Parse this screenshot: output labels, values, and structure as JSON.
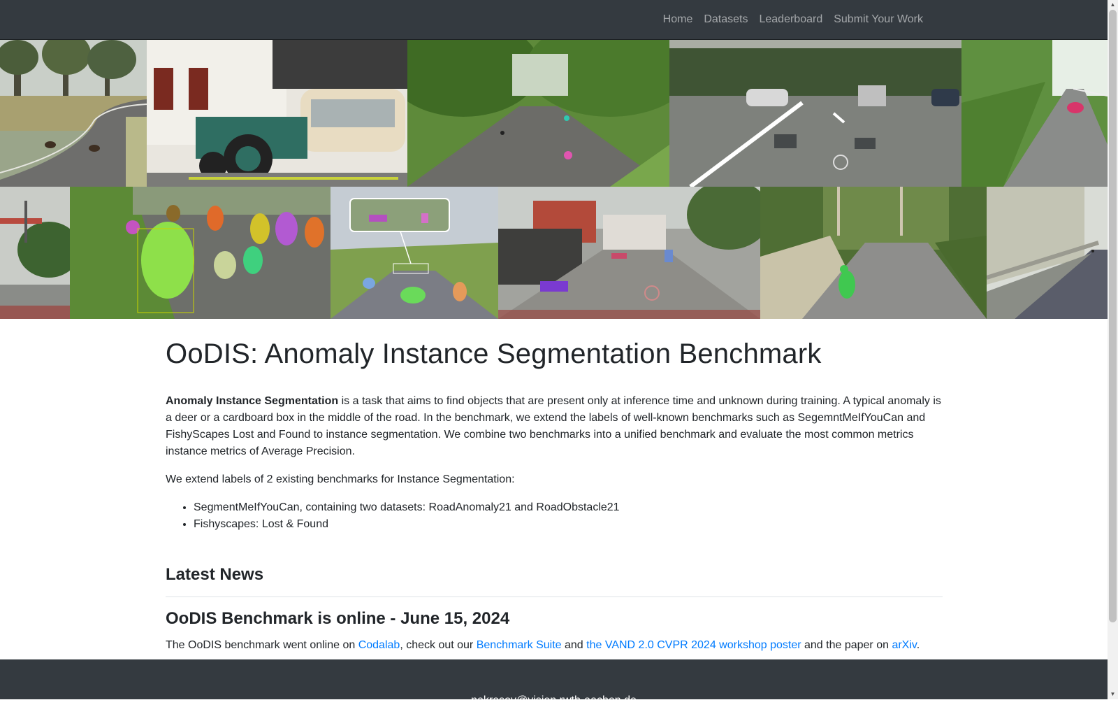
{
  "nav": {
    "items": [
      {
        "label": "Home"
      },
      {
        "label": "Datasets"
      },
      {
        "label": "Leaderboard"
      },
      {
        "label": "Submit Your Work"
      }
    ]
  },
  "main": {
    "title": "OoDIS: Anomaly Instance Segmentation Benchmark",
    "intro_bold": "Anomaly Instance Segmentation",
    "intro_rest": " is a task that aims to find objects that are present only at inference time and unknown during training. A typical anomaly is a deer or a cardboard box in the middle of the road. In the benchmark, we extend the labels of well-known benchmarks such as SegemntMeIfYouCan and FishyScapes Lost and Found to instance segmentation. We combine two benchmarks into a unified benchmark and evaluate the most common metrics instance metrics of Average Precision.",
    "extend_text": "We extend labels of 2 existing benchmarks for Instance Segmentation:",
    "bullets": [
      "SegmentMeIfYouCan, containing two datasets: RoadAnomaly21 and RoadObstacle21",
      "Fishyscapes: Lost & Found"
    ]
  },
  "news": {
    "heading": "Latest News",
    "item_title": "OoDIS Benchmark is online - June 15, 2024",
    "t1": "The OoDIS benchmark went online on ",
    "l1": "Codalab",
    "t2": ", check out our ",
    "l2": "Benchmark Suite",
    "t3": " and ",
    "l3": "the VAND 2.0 CVPR 2024 workshop poster",
    "t4": " and the paper on ",
    "l4": "arXiv",
    "t5": "."
  },
  "footer": {
    "email": "nekrasov@vision.rwth-aachen.de"
  },
  "colors": {
    "navbar_bg": "#343a40",
    "link": "#007bff",
    "text": "#212529"
  }
}
